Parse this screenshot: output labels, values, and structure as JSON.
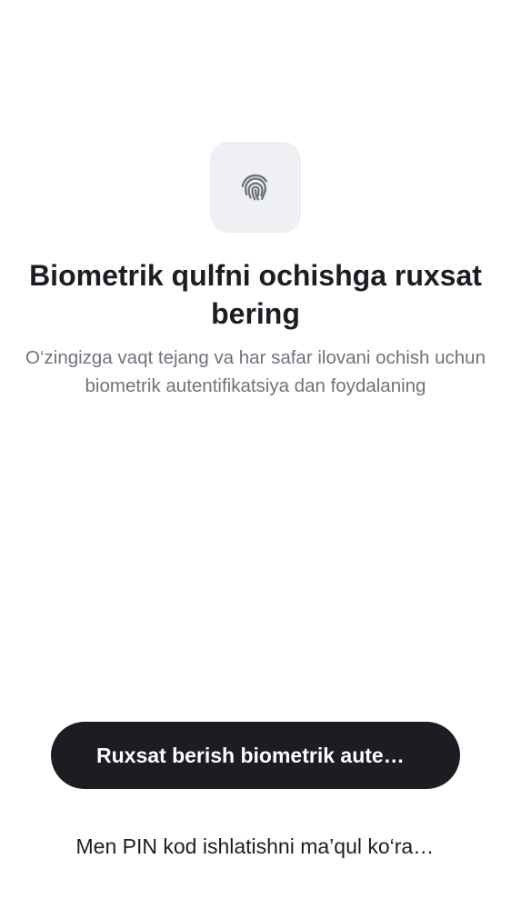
{
  "screen": {
    "icon": "fingerprint-icon",
    "title": "Biometrik qulfni ochishga ruxsat bering",
    "subtitle": "O‘zingizga vaqt tejang va har safar ilovani ochish uchun biometrik autentifikatsiya dan foydalaning"
  },
  "actions": {
    "allow_label": "Ruxsat berish biometrik autentifikatsiya",
    "pin_label": "Men PIN kod ishlatishni ma’qul ko‘raman"
  },
  "colors": {
    "background": "#ffffff",
    "icon_tile": "#eff0f4",
    "icon_stroke": "#6e727b",
    "title": "#1c1d22",
    "subtitle": "#6e727b",
    "primary_button": "#1c1d22",
    "primary_button_text": "#ffffff"
  }
}
